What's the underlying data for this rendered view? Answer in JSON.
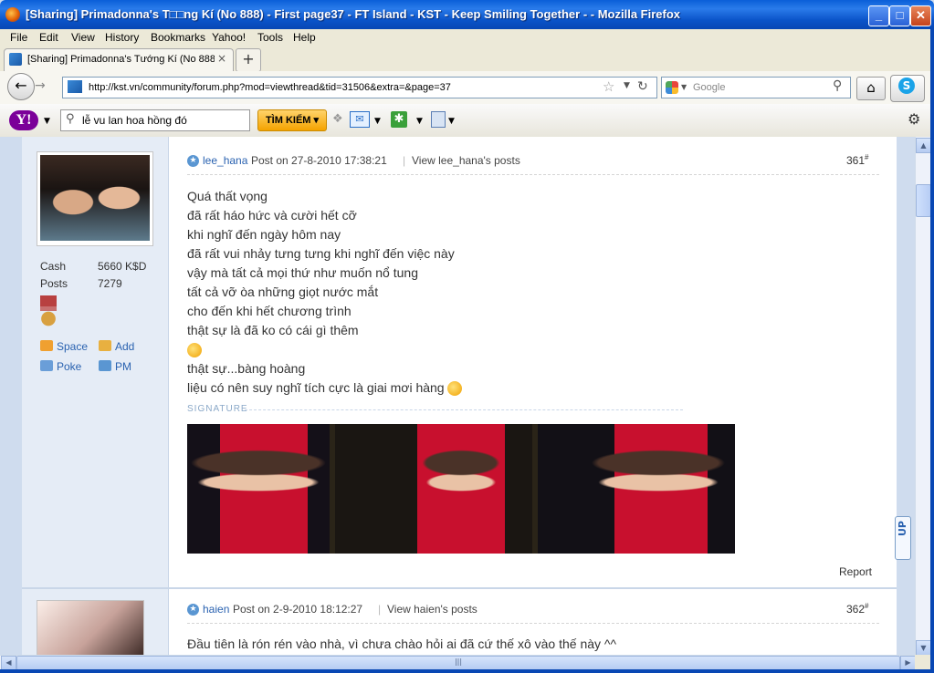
{
  "window": {
    "title": "[Sharing] Primadonna's T□□ng Kí (No 888) - First page37 - FT Island - KST - Keep Smiling Together - - Mozilla Firefox",
    "controls": [
      "_",
      "□",
      "✕"
    ]
  },
  "menu": [
    "File",
    "Edit",
    "View",
    "History",
    "Bookmarks",
    "Yahoo!",
    "Tools",
    "Help"
  ],
  "tab": {
    "label": "[Sharing] Primadonna's Tướng Kí (No 888) - ...",
    "close": "×",
    "new_tab": "+"
  },
  "nav": {
    "url": "http://kst.vn/community/forum.php?mod=viewthread&tid=31506&extra=&page=37",
    "search_placeholder": "Google"
  },
  "yahoo_toolbar": {
    "logo": "Y!",
    "search_text": "lễ vu lan hoa hồng đó",
    "search_button": "TÌM KIẾM ▾"
  },
  "post1": {
    "author": "lee_hana",
    "post_on": "Post on 27-8-2010 17:38:21",
    "view_posts": "View lee_hana's posts",
    "floor": "361",
    "floor_sup": "#",
    "stats": [
      {
        "label": "Cash",
        "value": "5660 K$D"
      },
      {
        "label": "Posts",
        "value": "7279"
      }
    ],
    "actions": [
      {
        "label": "Space",
        "icon": "home-icon"
      },
      {
        "label": "Add",
        "icon": "handshake-icon"
      },
      {
        "label": "Poke",
        "icon": "poke-icon"
      },
      {
        "label": "PM",
        "icon": "mail-icon"
      }
    ],
    "lines": [
      "Quá thất vọng",
      "đã rất háo hức và cười hết cỡ",
      "khi nghĩ đến ngày hôm nay",
      "đã rất vui nhảy tưng tưng khi nghĩ đến việc này",
      "vậy mà tất cả mọi thứ như muốn nổ tung",
      "tất cả vỡ òa những giọt nước mắt",
      "cho đến khi hết chương trình",
      "thật sự là đã ko có cái gì thêm",
      "",
      "thật sự...bàng hoàng",
      "liệu có nên suy nghĩ tích cực là giai mơi hàng"
    ],
    "signature_label": "SIGNATURE",
    "report": "Report"
  },
  "post2": {
    "author": "haien",
    "post_on": "Post on 2-9-2010 18:12:27",
    "view_posts": "View haien's posts",
    "floor": "362",
    "floor_sup": "#",
    "first_line": "Đầu tiên là rón rén vào nhà, vì chưa chào hỏi ai đã cứ thế xô vào thế này ^^"
  },
  "up_button": "UP",
  "colors": {
    "titlebar": "#0a53c8",
    "link": "#2a62b0",
    "sidebar": "#e5ecf6"
  }
}
